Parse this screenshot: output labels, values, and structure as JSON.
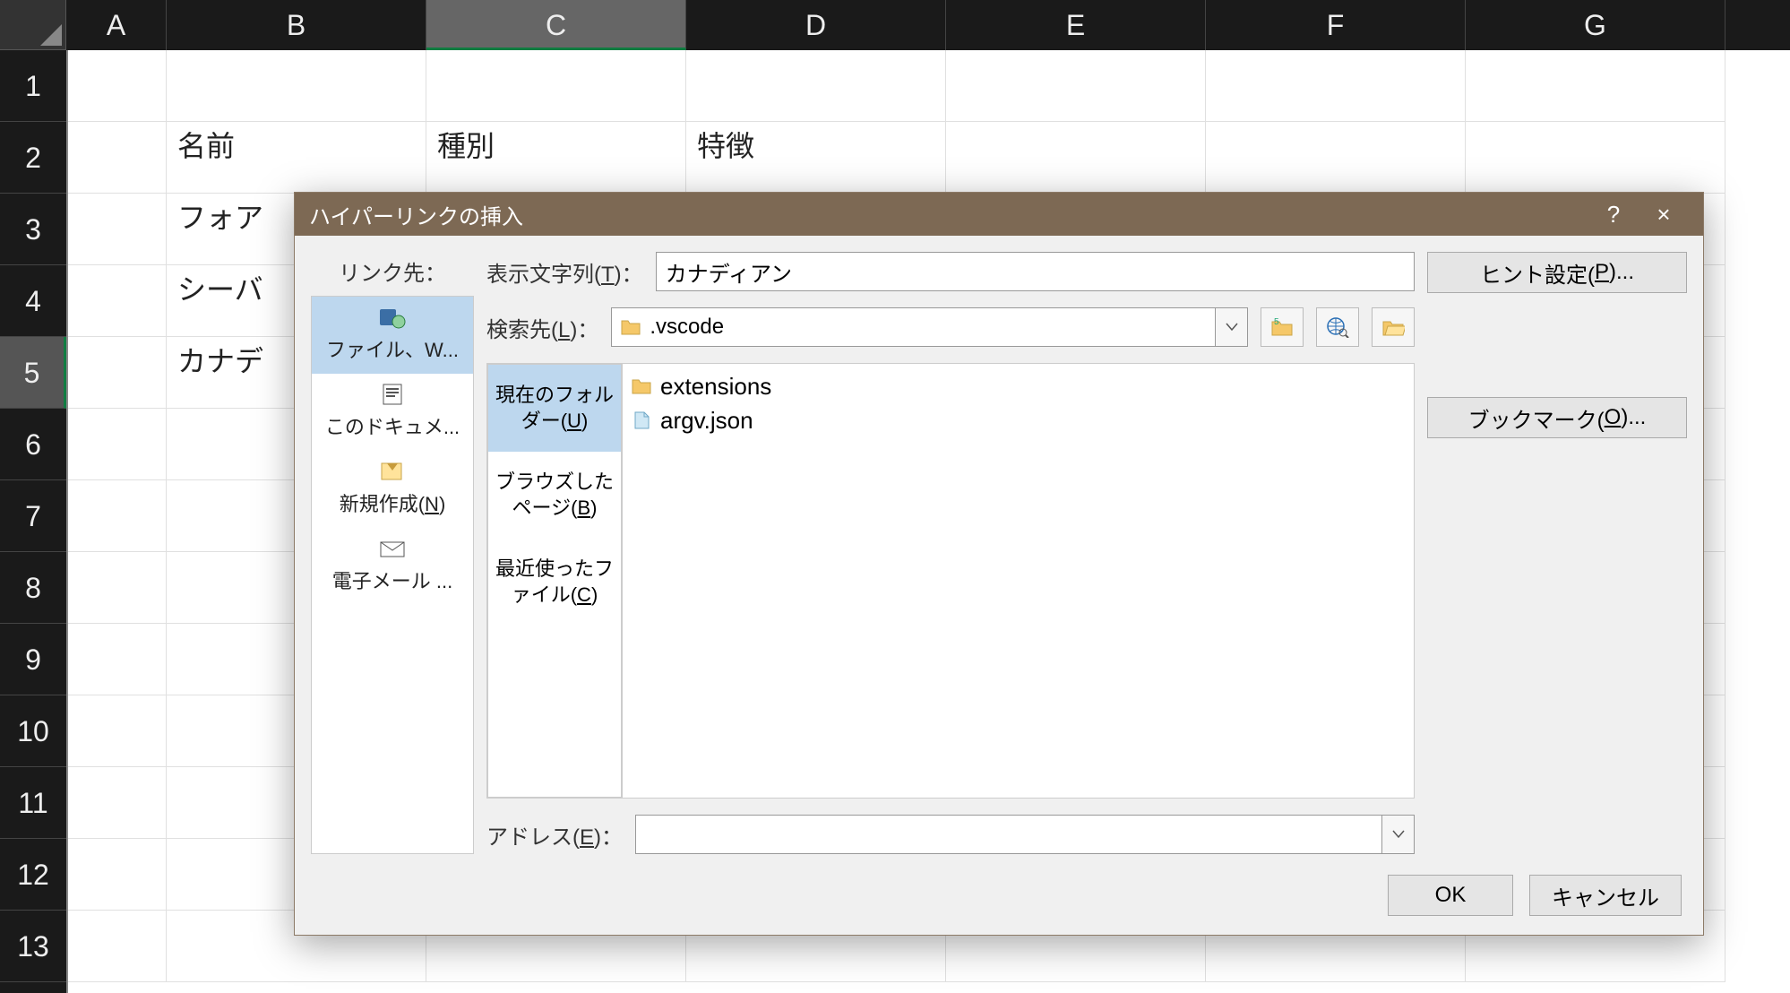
{
  "columns": [
    "A",
    "B",
    "C",
    "D",
    "E",
    "F",
    "G"
  ],
  "rows": [
    "1",
    "2",
    "3",
    "4",
    "5",
    "6",
    "7",
    "8",
    "9",
    "10",
    "11",
    "12",
    "13"
  ],
  "selected_col_index": 2,
  "selected_row_index": 4,
  "cells": {
    "B2": "名前",
    "C2": "種別",
    "D2": "特徴",
    "B3": "フォア",
    "B4": "シーバ",
    "B5": "カナデ"
  },
  "dialog": {
    "title": "ハイパーリンクの挿入",
    "help": "?",
    "close": "×",
    "link_to_label": "リンク先：",
    "targets": [
      {
        "label": "ファイル、W...",
        "selected": true
      },
      {
        "label": "このドキュメ..."
      },
      {
        "label": "新規作成(N)"
      },
      {
        "label": "電子メール ..."
      }
    ],
    "display_text_label": "表示文字列(T)：",
    "display_text_value": "カナディアン",
    "look_in_label": "検索先(L)：",
    "look_in_value": ".vscode",
    "sub_nav": [
      {
        "label": "現在のフォルダー(U)",
        "selected": true
      },
      {
        "label": "ブラウズしたページ(B)"
      },
      {
        "label": "最近使ったファイル(C)"
      }
    ],
    "files": [
      {
        "name": "extensions",
        "type": "folder"
      },
      {
        "name": "argv.json",
        "type": "file"
      }
    ],
    "address_label": "アドレス(E)：",
    "address_value": "",
    "tooltip_btn": "ヒント設定(P)...",
    "bookmark_btn": "ブックマーク(O)...",
    "ok": "OK",
    "cancel": "キャンセル"
  }
}
